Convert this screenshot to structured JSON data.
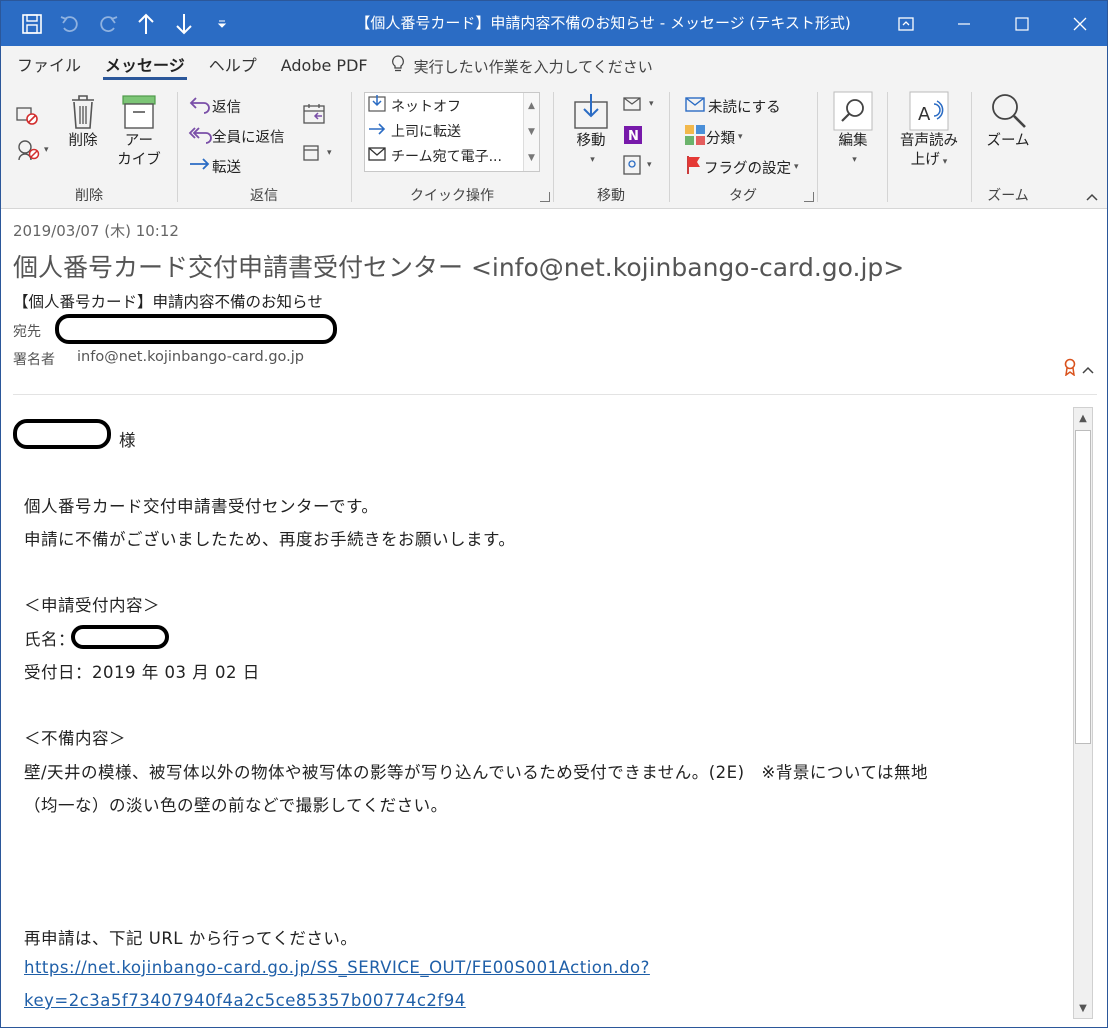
{
  "window": {
    "title": "【個人番号カード】申請内容不備のお知らせ  -  メッセージ (テキスト形式)"
  },
  "menu": {
    "tabs": [
      "ファイル",
      "メッセージ",
      "ヘルプ",
      "Adobe PDF"
    ],
    "active_tab": "メッセージ",
    "tell_me": "実行したい作業を入力してください"
  },
  "ribbon": {
    "delete_group": {
      "label": "削除",
      "delete": "削除",
      "archive_line1": "アー",
      "archive_line2": "カイブ"
    },
    "respond_group": {
      "label": "返信",
      "reply": "返信",
      "reply_all": "全員に返信",
      "forward": "転送"
    },
    "quick_group": {
      "label": "クイック操作",
      "items": [
        "ネットオフ",
        "上司に転送",
        "チーム宛て電子..."
      ]
    },
    "move_group": {
      "label": "移動",
      "move": "移動"
    },
    "tags_group": {
      "label": "タグ",
      "unread": "未読にする",
      "categorize": "分類",
      "flag": "フラグの設定"
    },
    "edit_group": {
      "edit": "編集"
    },
    "speech_group": {
      "line1": "音声読み",
      "line2": "上げ"
    },
    "zoom_group": {
      "label": "ズーム",
      "zoom": "ズーム"
    }
  },
  "header": {
    "date": "2019/03/07 (木) 10:12",
    "sender": "個人番号カード交付申請書受付センター <info@net.kojinbango-card.go.jp>",
    "subject": "【個人番号カード】申請内容不備のお知らせ",
    "to_label": "宛先",
    "signer_label": "署名者",
    "signer": "info@net.kojinbango-card.go.jp"
  },
  "body": {
    "salutation_suffix": "様",
    "line1": "個人番号カード交付申請書受付センターです。",
    "line2": "申請に不備がございましたため、再度お手続きをお願いします。",
    "section1": "＜申請受付内容＞",
    "name_label": "氏名：",
    "received_date": "受付日：2019 年 03 月 02 日",
    "section2": "＜不備内容＞",
    "defect1": "壁/天井の模様、被写体以外の物体や被写体の影等が写り込んでいるため受付できません。(2E)　※背景については無地",
    "defect2": "（均一な）の淡い色の壁の前などで撮影してください。",
    "reapply": "再申請は、下記 URL から行ってください。",
    "url_line1": "https://net.kojinbango-card.go.jp/SS_SERVICE_OUT/FE00S001Action.do?",
    "url_line2": "key=2c3a5f73407940f4a2c5ce85357b00774c2f94"
  }
}
